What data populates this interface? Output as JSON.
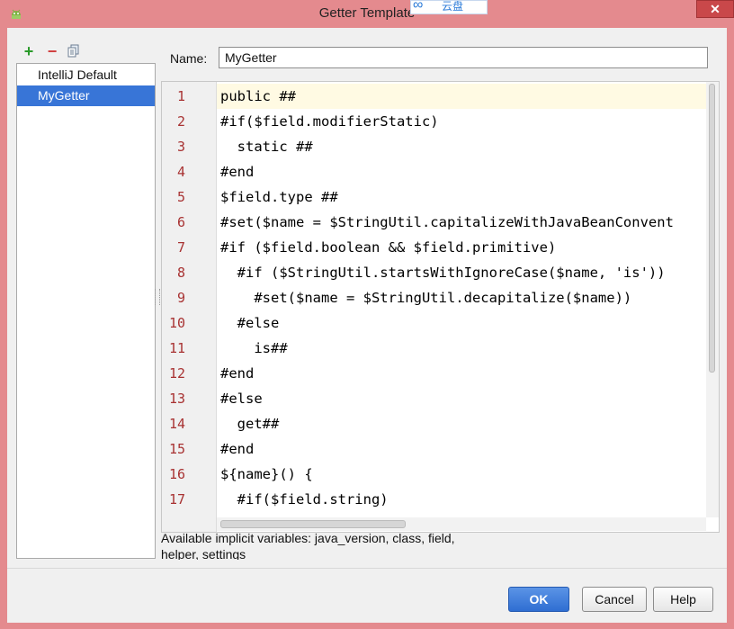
{
  "window": {
    "title": "Getter Template",
    "overlay_text": "云盘",
    "close_glyph": "✕"
  },
  "toolbar": {
    "add_glyph": "+",
    "remove_glyph": "−",
    "copy_icon": "copy-icon"
  },
  "templates": [
    {
      "label": "IntelliJ Default",
      "selected": false
    },
    {
      "label": "MyGetter",
      "selected": true
    }
  ],
  "name_field": {
    "label": "Name:",
    "value": "MyGetter"
  },
  "editor": {
    "current_line": 1,
    "lines": [
      {
        "num": "1",
        "text": "public ##"
      },
      {
        "num": "2",
        "text": "#if($field.modifierStatic)"
      },
      {
        "num": "3",
        "text": "  static ##"
      },
      {
        "num": "4",
        "text": "#end"
      },
      {
        "num": "5",
        "text": "$field.type ##"
      },
      {
        "num": "6",
        "text": "#set($name = $StringUtil.capitalizeWithJavaBeanConvent"
      },
      {
        "num": "7",
        "text": "#if ($field.boolean && $field.primitive)"
      },
      {
        "num": "8",
        "text": "  #if ($StringUtil.startsWithIgnoreCase($name, 'is'))"
      },
      {
        "num": "9",
        "text": "    #set($name = $StringUtil.decapitalize($name))"
      },
      {
        "num": "10",
        "text": "  #else"
      },
      {
        "num": "11",
        "text": "    is##"
      },
      {
        "num": "12",
        "text": "#end"
      },
      {
        "num": "13",
        "text": "#else"
      },
      {
        "num": "14",
        "text": "  get##"
      },
      {
        "num": "15",
        "text": "#end"
      },
      {
        "num": "16",
        "text": "${name}() {"
      },
      {
        "num": "17",
        "text": "  #if($field.string)"
      }
    ]
  },
  "hint": "Available implicit variables: java_version, class, field, helper, settings",
  "buttons": {
    "ok": "OK",
    "cancel": "Cancel",
    "help": "Help"
  },
  "colors": {
    "selection": "#3875d7",
    "line_number": "#a83232",
    "current_line_bg": "#fffae3",
    "add_green": "#2a9a2a",
    "remove_red": "#d04040"
  }
}
